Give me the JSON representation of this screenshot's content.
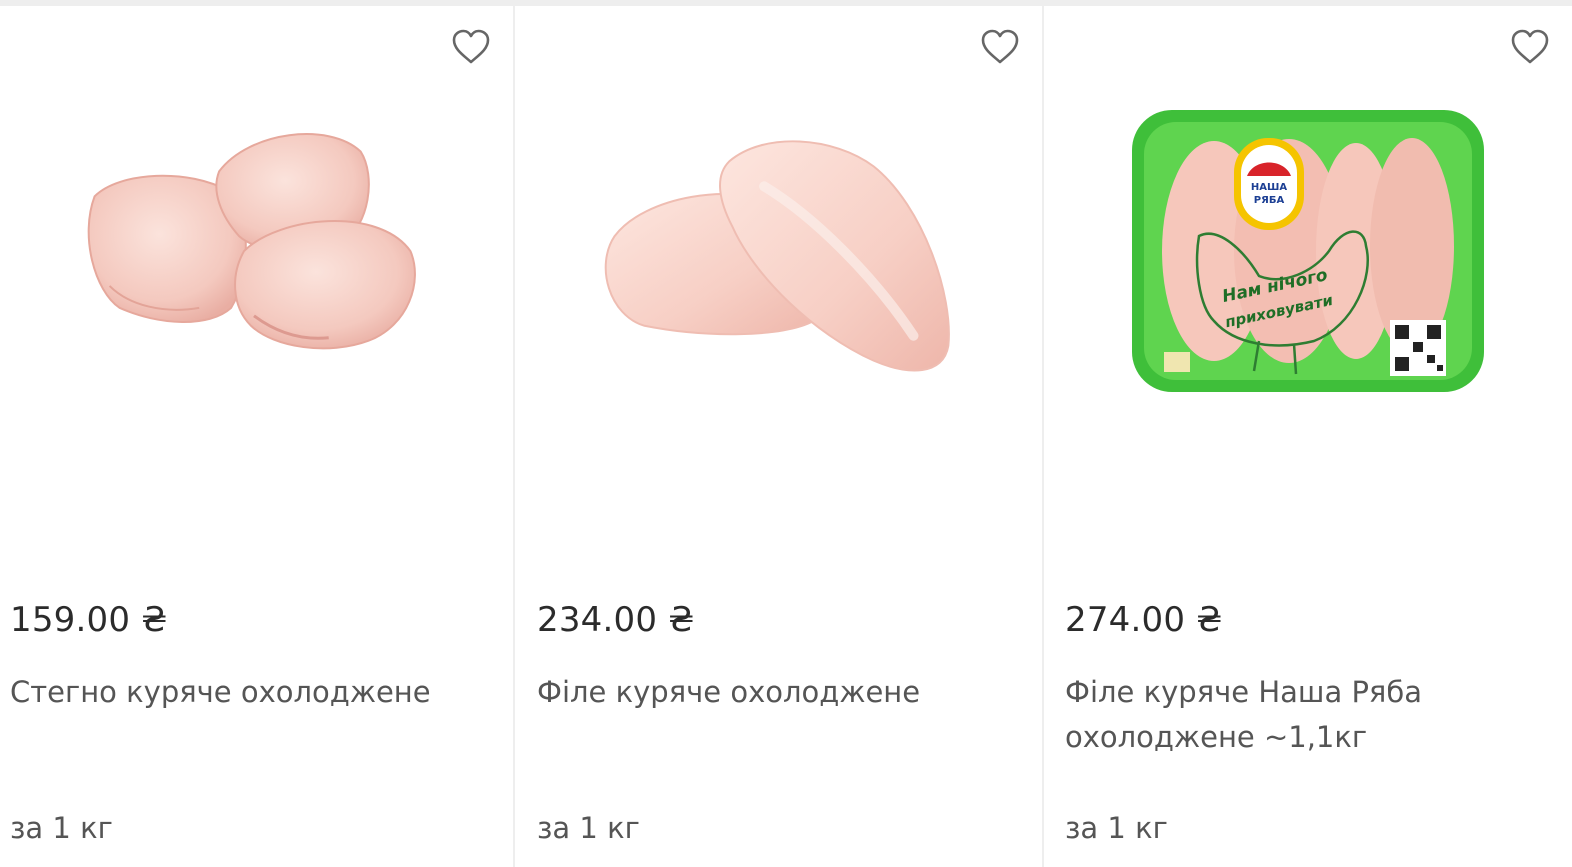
{
  "products": [
    {
      "price": "159.00 ₴",
      "name": "Стегно куряче охолоджене",
      "unit": "за 1 кг",
      "favorite_icon": "heart-outline-icon",
      "image": "chicken-thighs-image"
    },
    {
      "price": "234.00 ₴",
      "name": "Філе куряче охолоджене",
      "unit": "за 1 кг",
      "favorite_icon": "heart-outline-icon",
      "image": "chicken-fillet-image"
    },
    {
      "price": "274.00 ₴",
      "name": "Філе куряче Наша Ряба охолоджене ~1,1кг",
      "unit": "за 1 кг",
      "favorite_icon": "heart-outline-icon",
      "image": "nasha-ryaba-fillet-package-image",
      "package": {
        "brand_line1": "НАША",
        "brand_line2": "РЯБА",
        "slogan_line1": "Нам нічого",
        "slogan_line2": "приховувати"
      }
    }
  ],
  "colors": {
    "price": "#2b2b2b",
    "text": "#555555",
    "divider": "#eeeeee",
    "heart": "#666666",
    "package_green": "#3fbf3a"
  }
}
